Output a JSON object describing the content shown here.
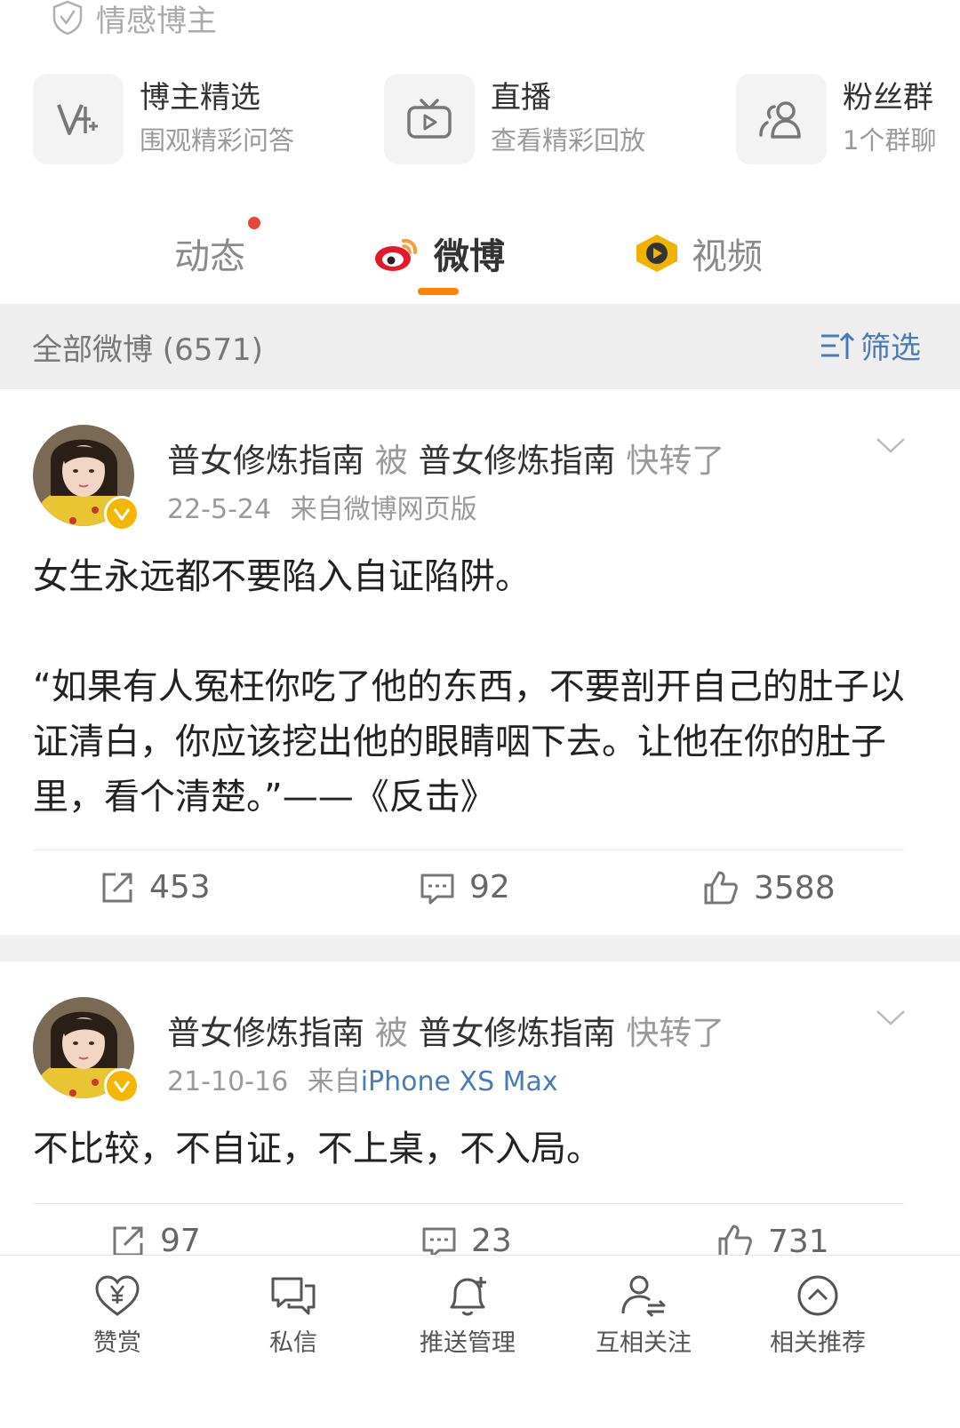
{
  "profile": {
    "tag_label": "情感博主"
  },
  "features": [
    {
      "title": "博主精选",
      "subtitle": "围观精彩问答",
      "icon": "v-plus-icon"
    },
    {
      "title": "直播",
      "subtitle": "查看精彩回放",
      "icon": "tv-icon"
    },
    {
      "title": "粉丝群",
      "subtitle": "1个群聊",
      "icon": "group-icon"
    }
  ],
  "tabs": [
    {
      "label": "动态",
      "has_dot": true
    },
    {
      "label": "微博",
      "active": true
    },
    {
      "label": "视频"
    }
  ],
  "filter_bar": {
    "count_label": "全部微博 (6571)",
    "filter_label": "筛选"
  },
  "posts": [
    {
      "author": "普女修炼指南",
      "by_word": "被",
      "forwarder": "普女修炼指南",
      "action_word": "快转了",
      "date": "22-5-24",
      "source_prefix": "来自",
      "source": "微博网页版",
      "text": "女生永远都不要陷入自证陷阱。\n\n“如果有人冤枉你吃了他的东西，不要剖开自己的肚子以证清白，你应该挖出他的眼睛咽下去。让他在你的肚子里，看个清楚。”——《反击》",
      "reposts": "453",
      "comments": "92",
      "likes": "3588"
    },
    {
      "author": "普女修炼指南",
      "by_word": "被",
      "forwarder": "普女修炼指南",
      "action_word": "快转了",
      "date": "21-10-16",
      "source_prefix": "来自",
      "source": "iPhone XS Max",
      "text": "不比较，不自证，不上桌，不入局。",
      "reposts": "97",
      "comments": "23",
      "likes": "731"
    }
  ],
  "bottom_nav": [
    {
      "label": "赞赏",
      "icon": "heart-yen-icon"
    },
    {
      "label": "私信",
      "icon": "chat-icon"
    },
    {
      "label": "推送管理",
      "icon": "bell-plus-icon"
    },
    {
      "label": "互相关注",
      "icon": "mutual-follow-icon"
    },
    {
      "label": "相关推荐",
      "icon": "chevron-up-circle-icon"
    }
  ],
  "colors": {
    "accent_orange": "#ff8200",
    "link_blue": "#4a7bb5",
    "badge_gold": "#f4b600",
    "notification_red": "#e8453c"
  }
}
